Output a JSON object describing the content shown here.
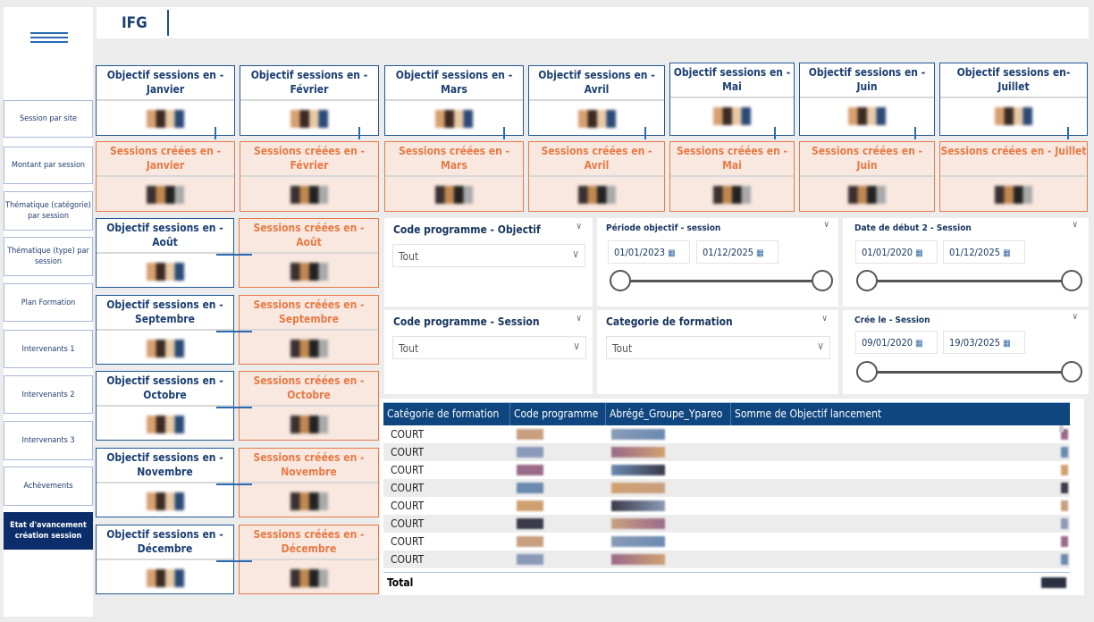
{
  "header": {
    "title": "IFG"
  },
  "sidebar": {
    "items": [
      {
        "label": "Session par site"
      },
      {
        "label": "Montant par session"
      },
      {
        "label": "Thématique (catégorie) par session"
      },
      {
        "label": "Thématique (type) par session"
      },
      {
        "label": "Plan Formation"
      },
      {
        "label": "Intervenants 1"
      },
      {
        "label": "Intervenants 2"
      },
      {
        "label": "Intervenants 3"
      },
      {
        "label": "Achèvements"
      },
      {
        "label": "Etat d'avancement création session",
        "active": true
      }
    ]
  },
  "top_cards": [
    {
      "objectif": "Objectif sessions en - Janvier",
      "creees": "Sessions créées en - Janvier"
    },
    {
      "objectif": "Objectif sessions en - Février",
      "creees": "Sessions créées en - Février"
    },
    {
      "objectif": "Objectif sessions en - Mars",
      "creees": "Sessions créées en - Mars"
    },
    {
      "objectif": "Objectif sessions en - Avril",
      "creees": "Sessions créées en - Avril"
    },
    {
      "objectif": "Objectif sessions en - Mai",
      "creees": "Sessions créées en - Mai"
    },
    {
      "objectif": "Objectif sessions en - Juin",
      "creees": "Sessions créées en - Juin"
    },
    {
      "objectif": "Objectif sessions en- Juillet",
      "creees": "Sessions créées en - Juillet"
    }
  ],
  "left_cards": [
    {
      "objectif": "Objectif sessions en - Août",
      "creees": "Sessions créées en - Août"
    },
    {
      "objectif": "Objectif sessions en - Septembre",
      "creees": "Sessions créées en - Septembre"
    },
    {
      "objectif": "Objectif sessions en - Octobre",
      "creees": "Sessions créées en - Octobre"
    },
    {
      "objectif": "Objectif sessions en - Novembre",
      "creees": "Sessions créées en - Novembre"
    },
    {
      "objectif": "Objectif sessions en - Décembre",
      "creees": "Sessions créées en - Décembre"
    }
  ],
  "slicers": {
    "code_obj": {
      "title": "Code programme - Objectif",
      "value": "Tout"
    },
    "periode": {
      "title": "Période objectif - session",
      "start": "01/01/2023",
      "end": "01/12/2025"
    },
    "date_debut": {
      "title": "Date de début 2 - Session",
      "start": "01/01/2020",
      "end": "01/12/2025"
    },
    "code_sess": {
      "title": "Code programme - Session",
      "value": "Tout"
    },
    "categorie": {
      "title": "Categorie de formation",
      "value": "Tout"
    },
    "cree_le": {
      "title": "Crée le - Session",
      "start": "09/01/2020",
      "end": "19/03/2025"
    }
  },
  "table": {
    "columns": [
      "Catégorie de formation",
      "Code programme",
      "Abrégé_Groupe_Ypareo",
      "Somme de Objectif lancement"
    ],
    "rows": [
      "COURT",
      "COURT",
      "COURT",
      "COURT",
      "COURT",
      "COURT",
      "COURT",
      "COURT"
    ],
    "total_label": "Total"
  }
}
